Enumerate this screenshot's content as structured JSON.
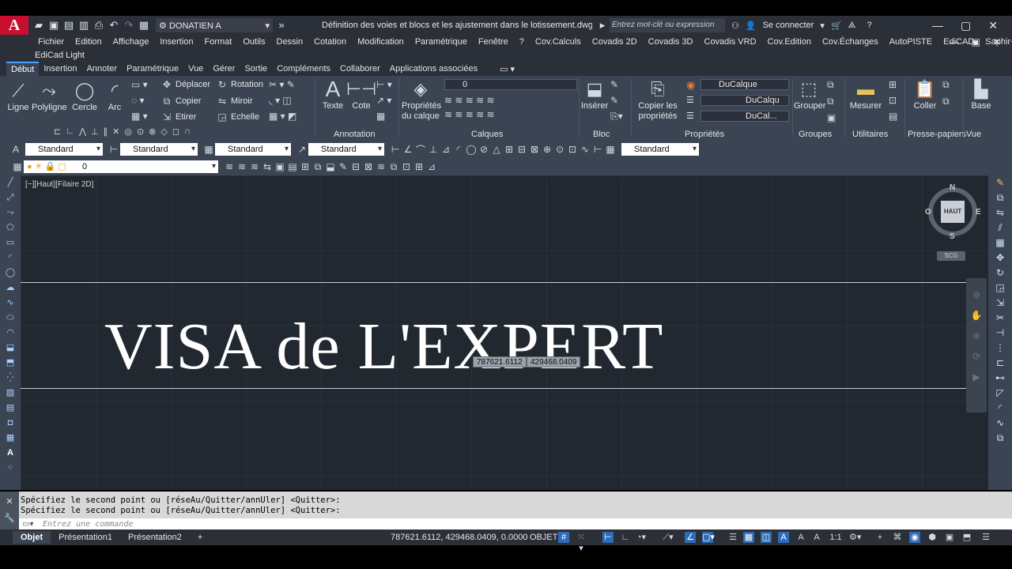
{
  "app": {
    "logo": "A",
    "workspace": "DONATIEN A",
    "doc_title": "Définition des voies et blocs et les ajustement dans le lotissement.dwg (1:20...",
    "search_placeholder": "Entrez mot-clé ou expression",
    "sign_in": "Se connecter",
    "help": "?"
  },
  "menu": {
    "row1": [
      "Fichier",
      "Edition",
      "Affichage",
      "Insertion",
      "Format",
      "Outils",
      "Dessin",
      "Cotation",
      "Modification",
      "Paramétrique",
      "Fenêtre",
      "?",
      "Cov.Calculs",
      "Covadis 2D",
      "Covadis 3D",
      "Covadis VRD",
      "Cov.Edition",
      "Cov.Échanges",
      "AutoPISTE",
      "EdiCAD",
      "Saphir+"
    ],
    "row2": "EdiCad Light"
  },
  "ribbon_tabs": [
    "Début",
    "Insertion",
    "Annoter",
    "Paramétrique",
    "Vue",
    "Gérer",
    "Sortie",
    "Compléments",
    "Collaborer",
    "Applications associées"
  ],
  "ribbon": {
    "dessin": {
      "ligne": "Ligne",
      "polyligne": "Polyligne",
      "cercle": "Cercle",
      "arc": "Arc"
    },
    "modification": {
      "deplacer": "Déplacer",
      "rotation": "Rotation",
      "copier": "Copier",
      "miroir": "Miroir",
      "etirer": "Etirer",
      "echelle": "Echelle"
    },
    "annotation": {
      "texte": "Texte",
      "cote": "Cote",
      "title": "Annotation"
    },
    "calques": {
      "proprietes": "Propriétés du calque",
      "current": "0",
      "title": "Calques"
    },
    "bloc": {
      "inserer": "Insérer",
      "title": "Bloc"
    },
    "proprietes": {
      "copier": "Copier les propriétés",
      "couleur": "DuCalque",
      "ltype": "DuCalqu",
      "lweight": "DuCal...",
      "title": "Propriétés"
    },
    "groupes": {
      "grouper": "Grouper",
      "title": "Groupes"
    },
    "utilitaires": {
      "mesurer": "Mesurer",
      "title": "Utilitaires"
    },
    "presse": {
      "coller": "Coller",
      "title": "Presse-papiers"
    },
    "vue": {
      "base": "Base",
      "title": "Vue"
    }
  },
  "toolbar1": {
    "style1": "Standard",
    "style2": "Standard",
    "style3": "Standard",
    "style4": "Standard",
    "style5": "Standard"
  },
  "toolbar2": {
    "layer": "0"
  },
  "drawing": {
    "view_label": "[−][Haut][Filaire 2D]",
    "text": "VISA de L'EXPERT",
    "tip_x": "787621.6112",
    "tip_y": "429468.0409",
    "compass": {
      "n": "N",
      "s": "S",
      "e": "E",
      "o": "O",
      "center": "HAUT",
      "ucs": "SCG"
    }
  },
  "command": {
    "line1": "Spécifiez le second point ou [réseAu/Quitter/annUler] <Quitter>:",
    "line2": "Spécifiez le second point ou [réseAu/Quitter/annUler] <Quitter>:",
    "placeholder": "Entrez une commande"
  },
  "status": {
    "tabs": [
      "Objet",
      "Présentation1",
      "Présentation2"
    ],
    "coords": "787621.6112, 429468.0409, 0.0000",
    "model": "OBJET",
    "scale": "1:1"
  }
}
